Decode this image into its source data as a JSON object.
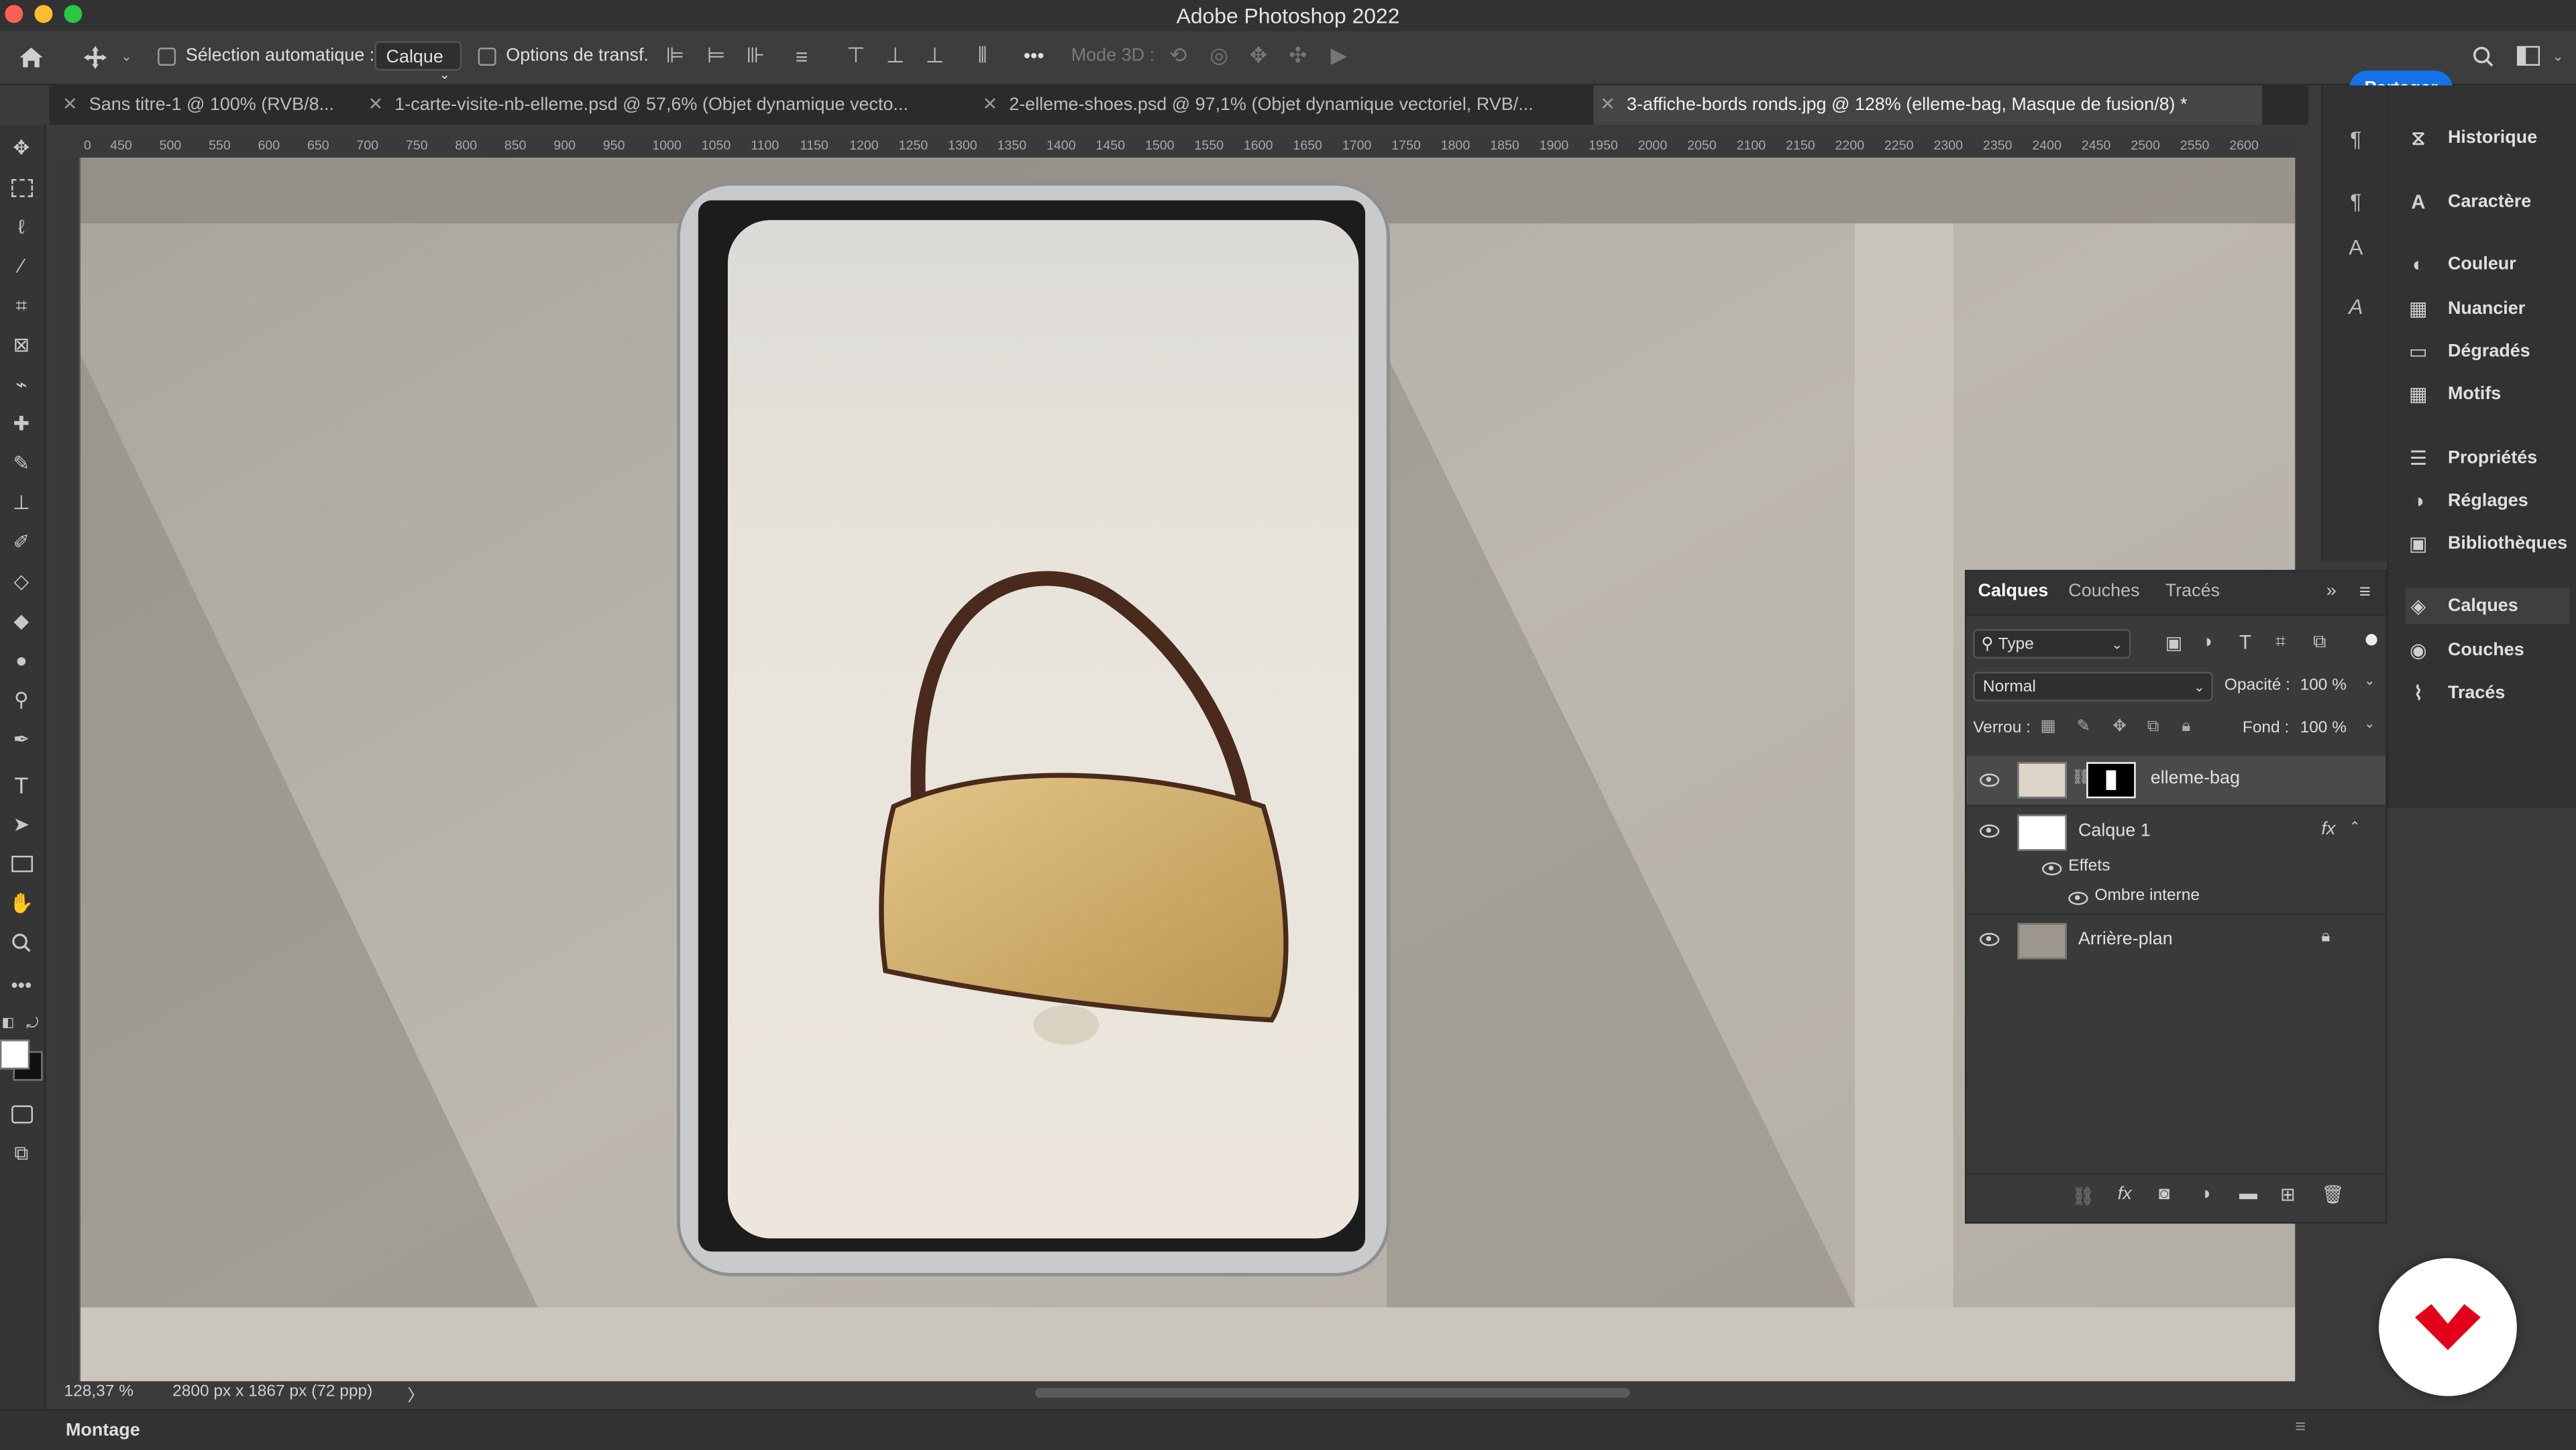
{
  "app": {
    "window_title": "Adobe Photoshop 2022"
  },
  "colors": {
    "accent": "#1473e6",
    "brand": "#e3001b",
    "panel": "#323232",
    "selection": "#4a4a4a"
  },
  "options_bar": {
    "home_icon": "home-icon",
    "move_icon": "move-icon",
    "auto_select_label": "Sélection automatique :",
    "auto_select_value": "Calque",
    "transform_options_label": "Options de transf.",
    "more_label": "•••",
    "mode3d_label": "Mode 3D :",
    "share_label": "Partager"
  },
  "tabs": [
    {
      "label": "Sans titre-1 @ 100% (RVB/8..."
    },
    {
      "label": "1-carte-visite-nb-elleme.psd @ 57,6% (Objet dynamique vecto..."
    },
    {
      "label": "2-elleme-shoes.psd @ 97,1% (Objet dynamique vectoriel, RVB/..."
    },
    {
      "label": "3-affiche-bords ronds.jpg @ 128% (elleme-bag, Masque de fusion/8) *"
    }
  ],
  "ruler_ticks": [
    "450",
    "500",
    "550",
    "600",
    "650",
    "700",
    "750",
    "800",
    "850",
    "900",
    "950",
    "1000",
    "1050",
    "1100",
    "1150",
    "1200",
    "1250",
    "1300",
    "1350",
    "1400",
    "1450",
    "1500",
    "1550",
    "1600",
    "1650",
    "1700",
    "1750",
    "1800",
    "1850",
    "1900",
    "1950",
    "2000",
    "2050",
    "2100",
    "2150",
    "2200",
    "2250",
    "2300",
    "2350",
    "2400",
    "2450",
    "2500",
    "2550",
    "2600"
  ],
  "status": {
    "zoom": "128,37 %",
    "doc_size": "2800 px x 1867 px (72 ppp)",
    "arrow": "〉",
    "workspace": "Montage"
  },
  "right_panel": {
    "items": [
      {
        "label": "Historique",
        "icon": "history-icon"
      },
      {
        "label": "Caractère",
        "icon": "character-icon"
      },
      {
        "label": "Couleur",
        "icon": "color-icon"
      },
      {
        "label": "Nuancier",
        "icon": "swatches-icon"
      },
      {
        "label": "Dégradés",
        "icon": "gradients-icon"
      },
      {
        "label": "Motifs",
        "icon": "patterns-icon"
      },
      {
        "label": "Propriétés",
        "icon": "properties-icon"
      },
      {
        "label": "Réglages",
        "icon": "adjustments-icon"
      },
      {
        "label": "Bibliothèques",
        "icon": "libraries-icon"
      },
      {
        "label": "Calques",
        "icon": "layers-icon"
      },
      {
        "label": "Couches",
        "icon": "channels-icon"
      },
      {
        "label": "Tracés",
        "icon": "paths-icon"
      }
    ]
  },
  "layers_panel": {
    "tabs": [
      "Calques",
      "Couches",
      "Tracés"
    ],
    "filter_label": "Type",
    "blend_mode": "Normal",
    "opacity_label": "Opacité :",
    "opacity_value": "100 %",
    "lock_label": "Verrou :",
    "fill_label": "Fond :",
    "fill_value": "100 %",
    "layers": [
      {
        "name": "elleme-bag",
        "selected": true
      },
      {
        "name": "Calque 1",
        "fx": "fx",
        "effects_label": "Effets",
        "effect_name": "Ombre interne"
      },
      {
        "name": "Arrière-plan",
        "locked": true
      }
    ]
  }
}
